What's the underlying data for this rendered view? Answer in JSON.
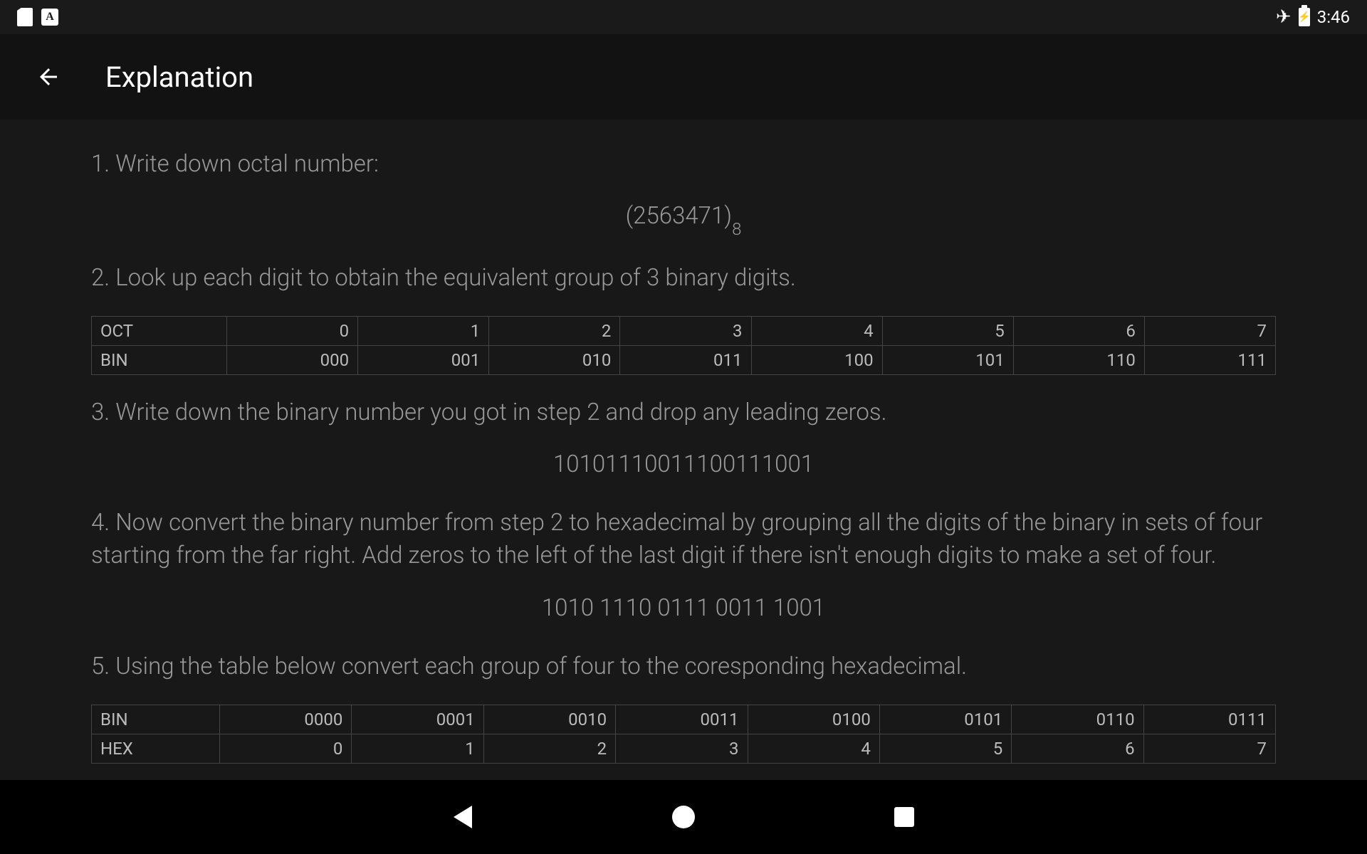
{
  "statusbar": {
    "a_letter": "A",
    "time": "3:46"
  },
  "header": {
    "title": "Explanation"
  },
  "content": {
    "step1": "1. Write down octal number:",
    "octal_value": "(2563471)",
    "octal_base": "8",
    "step2": "2. Look up each digit to obtain the equivalent group of 3 binary digits.",
    "table1": {
      "row1_label": "OCT",
      "row1": [
        "0",
        "1",
        "2",
        "3",
        "4",
        "5",
        "6",
        "7"
      ],
      "row2_label": "BIN",
      "row2": [
        "000",
        "001",
        "010",
        "011",
        "100",
        "101",
        "110",
        "111"
      ]
    },
    "step3": "3. Write down the binary number you got in step 2 and drop any leading zeros.",
    "binary_value": "10101110011100111001",
    "step4": "4. Now convert the binary number from step 2 to hexadecimal by grouping all the digits of the binary in sets of four starting from the far right. Add zeros to the left of the last digit if there isn't enough digits to make a set of four.",
    "grouped_value": "1010 1110 0111 0011 1001",
    "step5": "5. Using the table below convert each group of four to the coresponding hexadecimal.",
    "table2": {
      "row1_label": "BIN",
      "row1": [
        "0000",
        "0001",
        "0010",
        "0011",
        "0100",
        "0101",
        "0110",
        "0111"
      ],
      "row2_label": "HEX",
      "row2": [
        "0",
        "1",
        "2",
        "3",
        "4",
        "5",
        "6",
        "7"
      ]
    }
  }
}
